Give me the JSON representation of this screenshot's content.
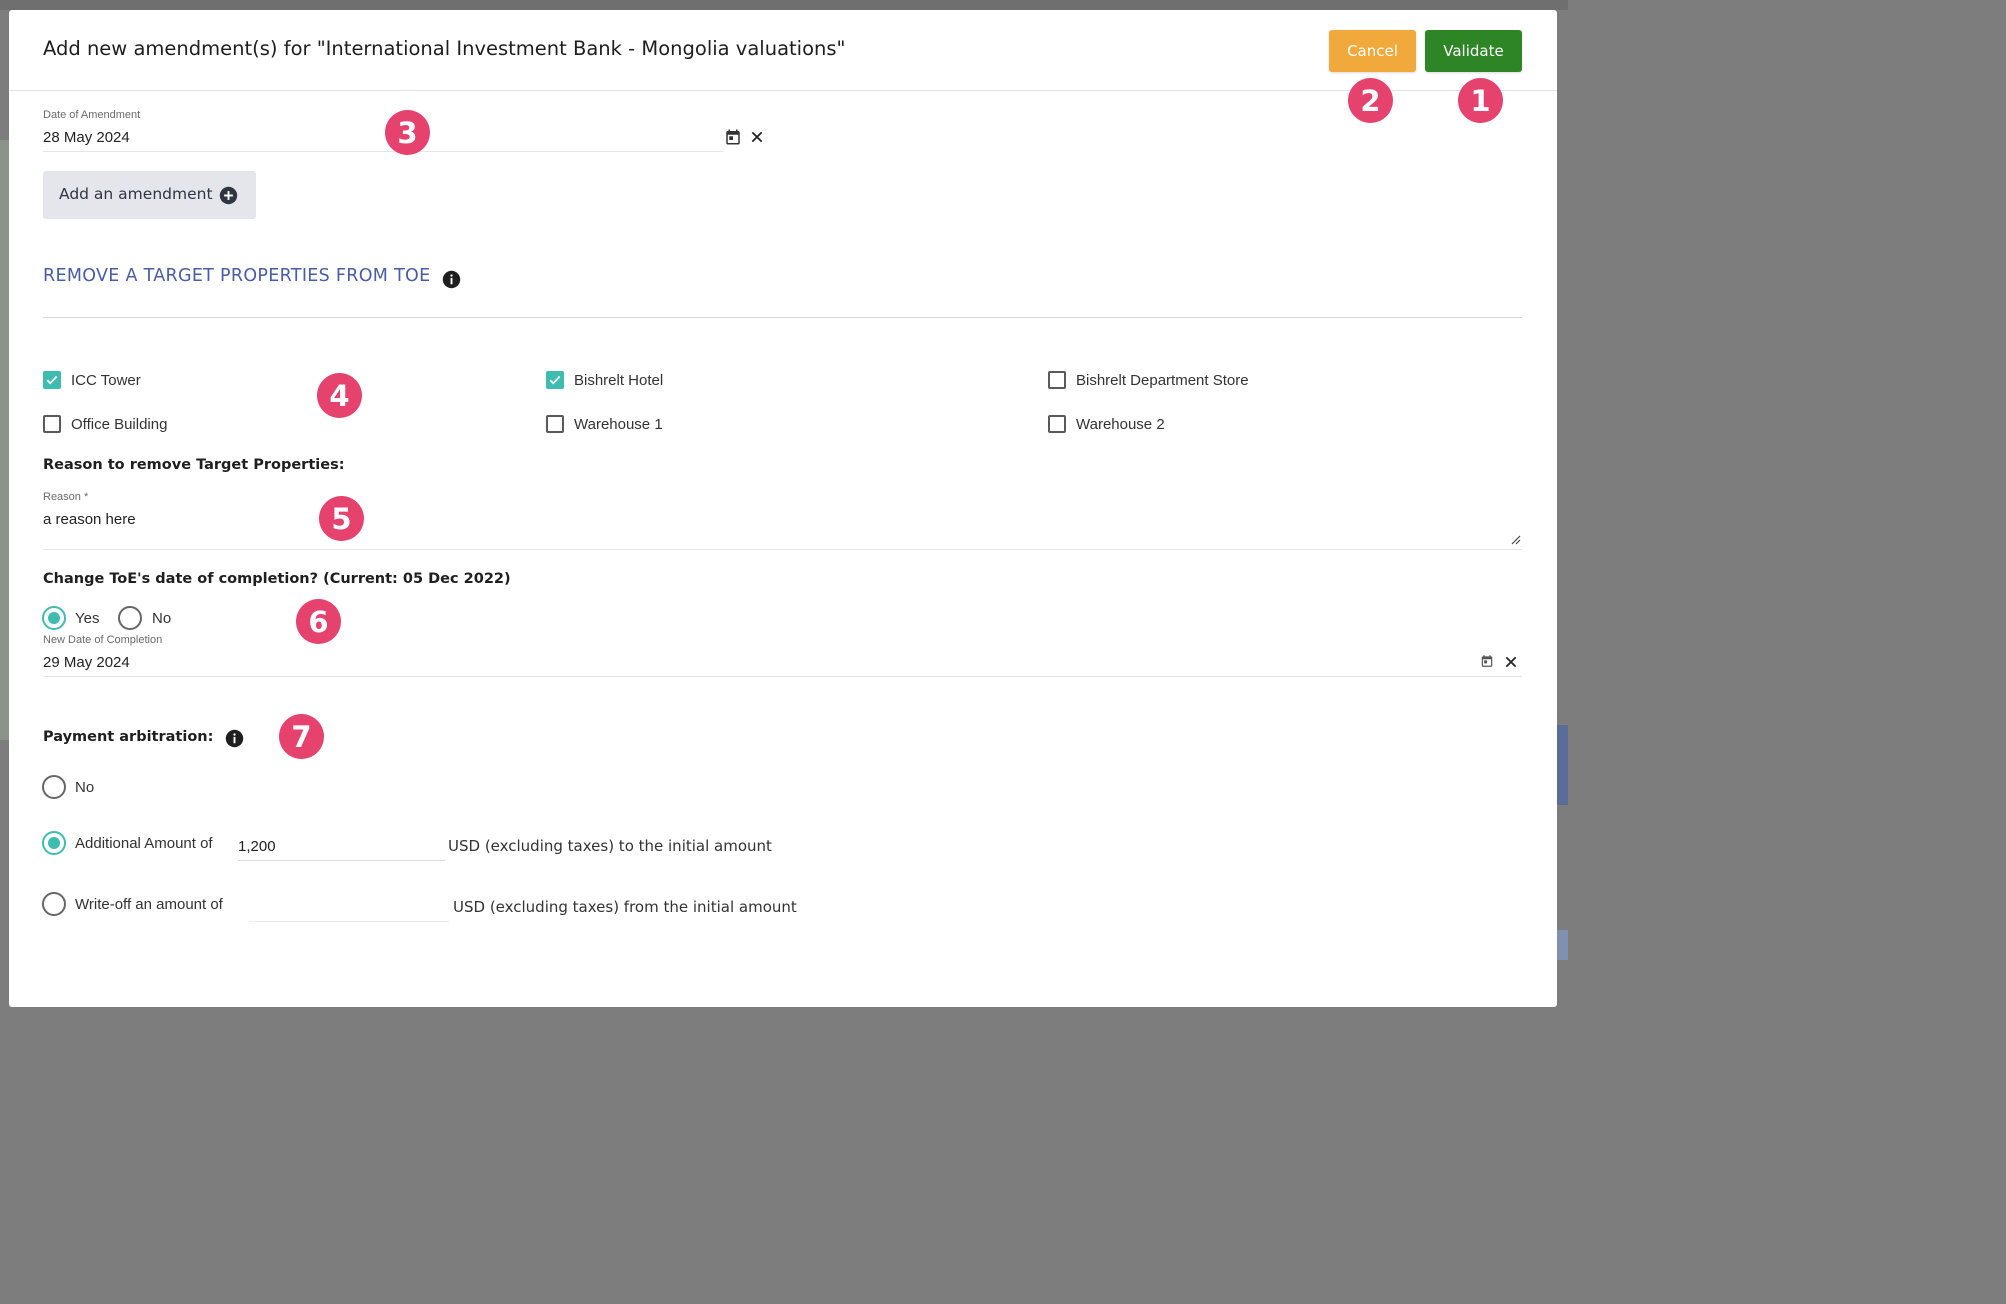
{
  "modal": {
    "title": "Add new amendment(s) for \"International Investment Bank - Mongolia valuations\"",
    "cancel_label": "Cancel",
    "validate_label": "Validate"
  },
  "amendment_date": {
    "label": "Date of Amendment",
    "value": "28 May 2024"
  },
  "add_amendment_label": "Add an amendment",
  "section": {
    "title": "REMOVE A TARGET PROPERTIES FROM TOE"
  },
  "properties": [
    {
      "label": "ICC Tower",
      "checked": true
    },
    {
      "label": "Bishrelt Hotel",
      "checked": true
    },
    {
      "label": "Bishrelt Department Store",
      "checked": false
    },
    {
      "label": "Office Building",
      "checked": false
    },
    {
      "label": "Warehouse 1",
      "checked": false
    },
    {
      "label": "Warehouse 2",
      "checked": false
    }
  ],
  "reason": {
    "heading": "Reason to remove Target Properties:",
    "label": "Reason *",
    "value": "a reason here"
  },
  "completion": {
    "heading": "Change ToE's date of completion? (Current: 05 Dec 2022)",
    "yes_label": "Yes",
    "no_label": "No",
    "selected": "Yes",
    "date_label": "New Date of Completion",
    "date_value": "29 May 2024"
  },
  "payment": {
    "heading": "Payment arbitration:",
    "option_no": "No",
    "option_additional": "Additional Amount of",
    "additional_value": "1,200",
    "additional_suffix": "USD (excluding taxes) to the initial amount",
    "option_writeoff": "Write-off an amount of",
    "writeoff_value": "",
    "writeoff_suffix": "USD (excluding taxes) from the initial amount",
    "selected": "Additional Amount of"
  },
  "markers": [
    "1",
    "2",
    "3",
    "4",
    "5",
    "6",
    "7"
  ],
  "colors": {
    "accent": "#3fbcb0",
    "marker": "#e5436e",
    "cancel": "#f2a93b",
    "validate": "#2e8526",
    "section_title": "#4a5ca6"
  },
  "icons": [
    "calendar-icon",
    "clear-icon",
    "add-circle-icon",
    "info-icon",
    "check-icon",
    "resize-handle-icon"
  ]
}
